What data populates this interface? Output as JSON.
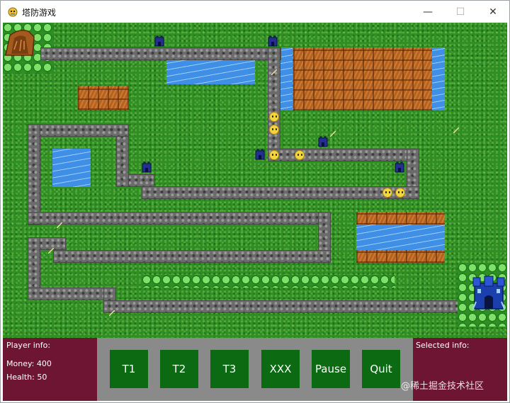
{
  "window": {
    "title": "塔防游戏",
    "minimize_glyph": "—",
    "maximize_glyph": "☐",
    "close_glyph": "✕"
  },
  "game": {
    "icons": [
      "tower-icon",
      "enemy-icon",
      "castle-icon",
      "cave-entrance-icon",
      "bush-icon"
    ]
  },
  "player_info": {
    "heading": "Player info:",
    "money_label": "Money: 400",
    "health_label": "Health: 50"
  },
  "toolbar": {
    "buttons": [
      "T1",
      "T2",
      "T3",
      "XXX",
      "Pause",
      "Quit"
    ]
  },
  "selected_info": {
    "heading": "Selected info:"
  },
  "watermark": "@稀土掘金技术社区",
  "colors": {
    "grass": "#2f8f25",
    "path": "#6b6b6b",
    "water": "#3f8fe6",
    "dirt": "#b5621f",
    "info_panel": "#6e1533",
    "button_panel": "#8a8a8a",
    "button": "#0b6a12"
  }
}
